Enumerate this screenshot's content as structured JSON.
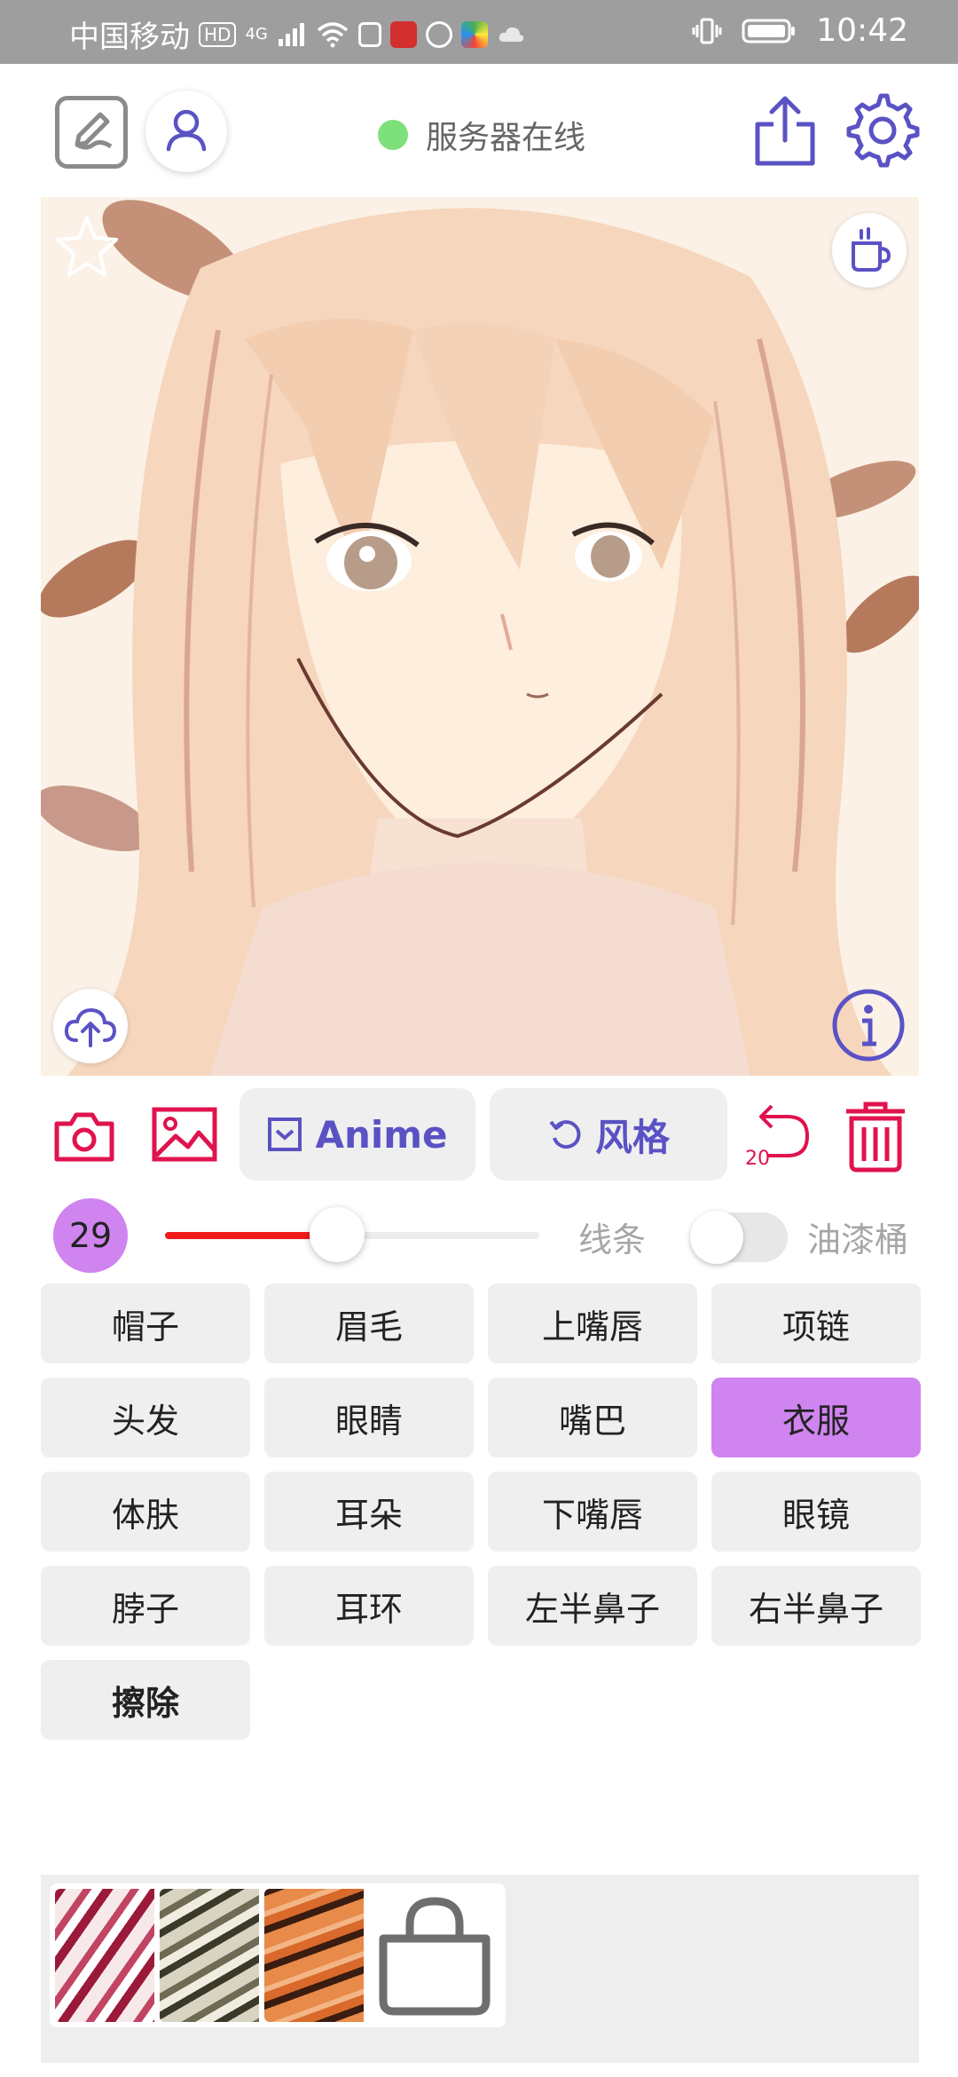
{
  "status_bar": {
    "carrier": "中国移动",
    "hd": "HD",
    "network": "4G",
    "time": "10:42"
  },
  "topbar": {
    "server_status": "服务器在线",
    "server_status_color": "#7de07a"
  },
  "toolbar": {
    "anime_label": "Anime",
    "style_label": "风格",
    "undo_count": "20",
    "accent_color": "#5a52c4",
    "danger_color": "#e0134e"
  },
  "brush": {
    "size": "29",
    "slider_fraction": 0.46,
    "line_label": "线条",
    "bucket_label": "油漆桶",
    "bucket_enabled": false
  },
  "parts": [
    {
      "label": "帽子",
      "selected": false
    },
    {
      "label": "眉毛",
      "selected": false
    },
    {
      "label": "上嘴唇",
      "selected": false
    },
    {
      "label": "项链",
      "selected": false
    },
    {
      "label": "头发",
      "selected": false
    },
    {
      "label": "眼睛",
      "selected": false
    },
    {
      "label": "嘴巴",
      "selected": false
    },
    {
      "label": "衣服",
      "selected": true
    },
    {
      "label": "体肤",
      "selected": false
    },
    {
      "label": "耳朵",
      "selected": false
    },
    {
      "label": "下嘴唇",
      "selected": false
    },
    {
      "label": "眼镜",
      "selected": false
    },
    {
      "label": "脖子",
      "selected": false
    },
    {
      "label": "耳环",
      "selected": false
    },
    {
      "label": "左半鼻子",
      "selected": false
    },
    {
      "label": "右半鼻子",
      "selected": false
    },
    {
      "label": "擦除",
      "selected": false,
      "bold": true
    }
  ],
  "selected_color": "#cf84ef"
}
